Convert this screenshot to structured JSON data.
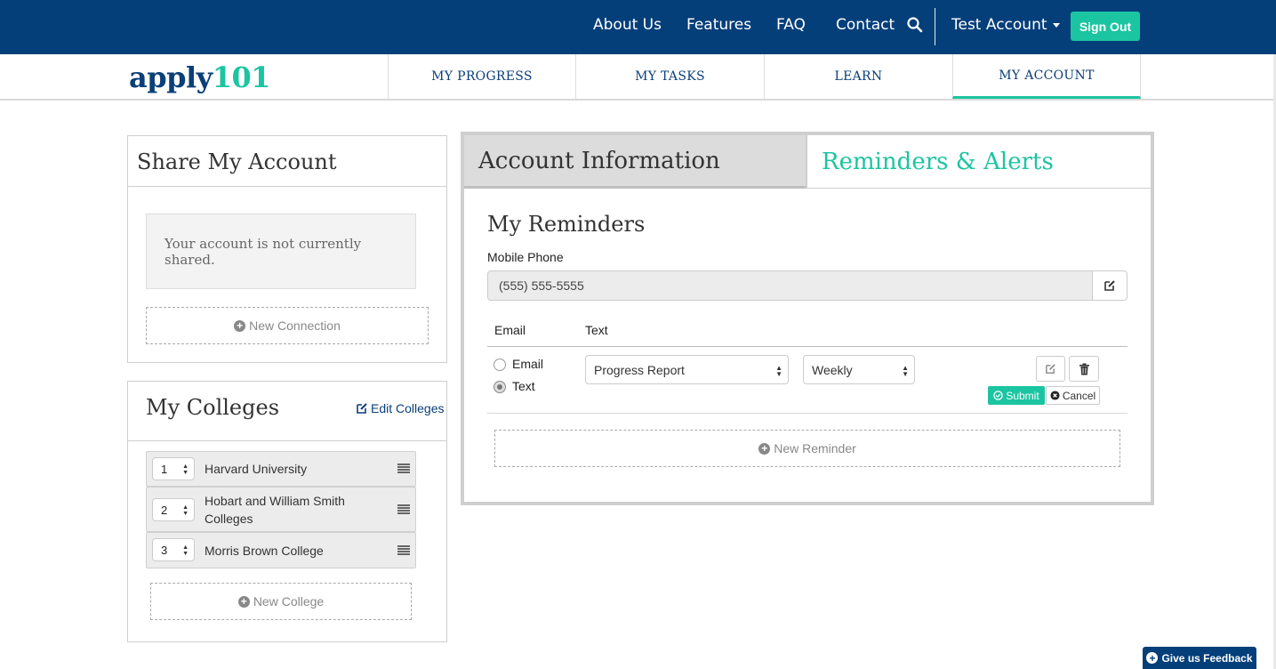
{
  "topnav": {
    "links": [
      "About Us",
      "Features",
      "FAQ",
      "Contact"
    ],
    "account_label": "Test Account",
    "signout_label": "Sign Out"
  },
  "logo": {
    "text": "apply",
    "num": "101"
  },
  "subnav": {
    "tabs": [
      "MY PROGRESS",
      "MY TASKS",
      "LEARN",
      "MY ACCOUNT"
    ],
    "active": "MY ACCOUNT"
  },
  "share": {
    "title": "Share My Account",
    "message": "Your account is not currently shared.",
    "new_connection": "New Connection"
  },
  "colleges": {
    "title": "My Colleges",
    "edit_label": "Edit Colleges",
    "items": [
      {
        "rank": "1",
        "name": "Harvard University"
      },
      {
        "rank": "2",
        "name": "Hobart and William Smith Colleges"
      },
      {
        "rank": "3",
        "name": "Morris Brown College"
      }
    ],
    "new_college": "New College"
  },
  "tabs": {
    "account_info": "Account Information",
    "reminders": "Reminders & Alerts"
  },
  "reminders": {
    "title": "My Reminders",
    "phone_label": "Mobile Phone",
    "phone_value": "(555) 555-5555",
    "col_email": "Email",
    "col_text": "Text",
    "radio_email": "Email",
    "radio_text": "Text",
    "type_value": "Progress Report",
    "freq_value": "Weekly",
    "submit": "Submit",
    "cancel": "Cancel",
    "new_reminder": "New Reminder"
  },
  "feedback": "Give us Feedback",
  "colors": {
    "navy": "#053f7a",
    "teal": "#1cc5a1"
  }
}
